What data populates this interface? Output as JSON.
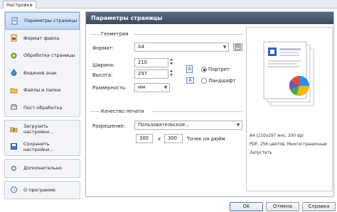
{
  "tab_label": "Настройки",
  "sidebar": {
    "group1": [
      {
        "label": "Параметры страницы",
        "icon": "page-setup-icon",
        "active": true
      },
      {
        "label": "Формат файла",
        "icon": "file-format-icon"
      },
      {
        "label": "Обработка страницы",
        "icon": "page-processing-icon"
      },
      {
        "label": "Водяной знак",
        "icon": "watermark-icon"
      },
      {
        "label": "Файлы и папки",
        "icon": "folder-icon"
      },
      {
        "label": "Пост-обработка",
        "icon": "post-processing-icon"
      }
    ],
    "group2": [
      {
        "label": "Загрузить настройки...",
        "icon": "load-settings-icon"
      },
      {
        "label": "Сохранить настройки...",
        "icon": "save-settings-icon"
      }
    ],
    "group3": [
      {
        "label": "Дополнительно",
        "icon": "advanced-icon"
      }
    ],
    "group4": [
      {
        "label": "О программе",
        "icon": "about-icon"
      }
    ]
  },
  "panel": {
    "title": "Параметры страницы",
    "geometry": {
      "section_title": "Геометрия",
      "format_label": "Формат:",
      "format_value": "A4",
      "width_label": "Ширина:",
      "width_value": "210",
      "height_label": "Высота:",
      "height_value": "297",
      "units_label": "Размерность:",
      "units_value": "мм",
      "portrait_label": "Портрет",
      "landscape_label": "Ландшафт",
      "orientation_selected": "portrait"
    },
    "quality": {
      "section_title": "Качество печати",
      "resolution_label": "Разрешение:",
      "resolution_value": "Пользовательское...",
      "dpi_x": "300",
      "dpi_sep": "x",
      "dpi_y": "300",
      "dpi_unit": "Точек на дюйм"
    },
    "preview": {
      "line1": "A4 (210x297 мм), 300 dpi",
      "line2": "PDF, 256 цветов, Многостраничный",
      "line3": "Запустить"
    }
  },
  "footer": {
    "ok": "OK",
    "cancel": "Отмена",
    "help": "Справка"
  }
}
